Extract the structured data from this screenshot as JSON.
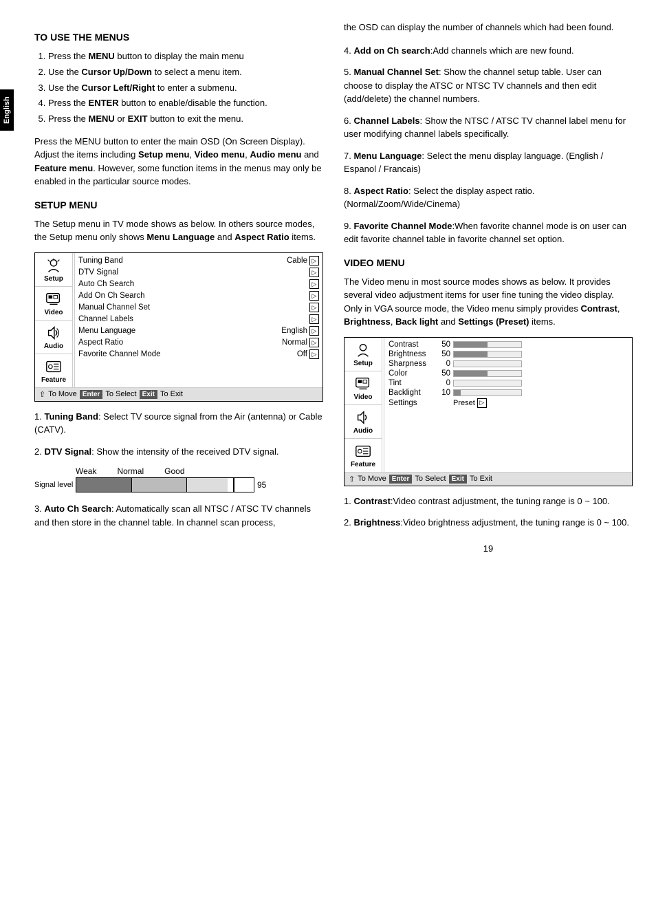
{
  "side_label": "English",
  "left": {
    "section1_title": "TO USE THE MENUS",
    "steps": [
      "Press the <b>MENU</b> button to display the main menu",
      "Use the <b>Cursor Up/Down</b> to select a menu item.",
      "Use the <b>Cursor Left/Right</b> to enter a submenu.",
      "Press the <b>ENTER</b> button to enable/disable the function.",
      "Press the <b>MENU</b> or <b>EXIT</b> button to exit the menu."
    ],
    "intro_text": "Press the MENU button to enter the main OSD (On Screen Display). Adjust the items including Setup menu, Video menu, Audio menu and Feature menu. However, some function items in the menus may only be enabled in the particular source modes.",
    "section2_title": "SETUP MENU",
    "setup_intro": "The Setup menu in TV mode shows as below. In others source modes, the Setup menu only shows Menu Language and Aspect Ratio items.",
    "menu_items": [
      {
        "name": "Tuning Band",
        "value": "Cable",
        "has_arrow": true
      },
      {
        "name": "DTV Signal",
        "value": "",
        "has_arrow": true
      },
      {
        "name": "Auto Ch Search",
        "value": "",
        "has_arrow": true
      },
      {
        "name": "Add On Ch Search",
        "value": "",
        "has_arrow": true
      },
      {
        "name": "Manual Channel Set",
        "value": "",
        "has_arrow": true
      },
      {
        "name": "Channel Labels",
        "value": "",
        "has_arrow": true
      },
      {
        "name": "Menu Language",
        "value": "English",
        "has_arrow": true
      },
      {
        "name": "Aspect Ratio",
        "value": "Normal",
        "has_arrow": true
      },
      {
        "name": "Favorite Channel Mode",
        "value": "Off",
        "has_arrow": true
      }
    ],
    "menu_icons": [
      {
        "label": "Setup",
        "id": "setup"
      },
      {
        "label": "Video",
        "id": "video"
      },
      {
        "label": "Audio",
        "id": "audio"
      },
      {
        "label": "Feature",
        "id": "feature"
      }
    ],
    "footer_text": "To Move",
    "footer_enter": "Enter",
    "footer_select": "To Select",
    "footer_exit": "Exit",
    "footer_to_exit": "To Exit",
    "numbered_items": [
      {
        "num": "1.",
        "label": "Tuning Band",
        "text": ": Select TV source signal from the Air (antenna) or Cable (CATV)."
      },
      {
        "num": "2.",
        "label": "DTV Signal",
        "text": ": Show the intensity of the received DTV signal."
      }
    ],
    "signal_labels": [
      "Weak",
      "Normal",
      "Good"
    ],
    "signal_row_label": "Signal level",
    "signal_value": "95",
    "item3": {
      "num": "3.",
      "label": "Auto Ch Search",
      "text": ": Automatically scan all NTSC / ATSC TV channels and then store in the channel table. In channel scan process,"
    }
  },
  "right": {
    "continued_text": "the OSD can display the number of channels which had been found.",
    "items": [
      {
        "num": "4.",
        "label": "Add on Ch search",
        "text": ":Add channels which are new found."
      },
      {
        "num": "5.",
        "label": "Manual Channel Set",
        "text": ": Show the channel setup table. User can choose to display the ATSC or NTSC TV channels and then edit (add/delete) the channel numbers."
      },
      {
        "num": "6.",
        "label": "Channel Labels",
        "text": ": Show the NTSC / ATSC TV channel label menu for user modifying channel labels specifically."
      },
      {
        "num": "7.",
        "label": "Menu Language",
        "text": ": Select the menu display language. (English / Espanol / Francais)"
      },
      {
        "num": "8.",
        "label": "Aspect Ratio",
        "text": ": Select the display aspect ratio. (Normal/Zoom/Wide/Cinema)"
      },
      {
        "num": "9.",
        "label": "Favorite Channel Mode",
        "text": ":When favorite channel mode is on user can edit favorite channel table in favorite channel set option."
      }
    ],
    "video_section_title": "VIDEO MENU",
    "video_intro": "The Video menu in most source modes shows as below. It provides several video adjustment items for user fine tuning the video display. Only in VGA source mode, the Video menu simply provides Contrast, Brightness, Back light and Settings (Preset) items.",
    "video_menu_items": [
      {
        "name": "Contrast",
        "value": 50,
        "pct": 50
      },
      {
        "name": "Brightness",
        "value": 50,
        "pct": 50
      },
      {
        "name": "Sharpness",
        "value": 0,
        "pct": 0
      },
      {
        "name": "Color",
        "value": 50,
        "pct": 50
      },
      {
        "name": "Tint",
        "value": 0,
        "pct": 0
      },
      {
        "name": "Backlight",
        "value": 10,
        "pct": 10
      },
      {
        "name": "Settings",
        "value": "",
        "pct": -1,
        "special": "Preset"
      }
    ],
    "video_footer_text": "To Move",
    "video_footer_enter": "Enter",
    "video_footer_select": "To Select",
    "video_footer_exit": "Exit",
    "video_footer_to_exit": "To Exit",
    "video_numbered": [
      {
        "num": "1.",
        "label": "Contrast",
        "text": ":Video contrast adjustment, the tuning range is 0 ~ 100."
      },
      {
        "num": "2.",
        "label": "Brightness",
        "text": ":Video brightness adjustment, the tuning range is 0 ~ 100."
      }
    ],
    "page_num": "19"
  }
}
